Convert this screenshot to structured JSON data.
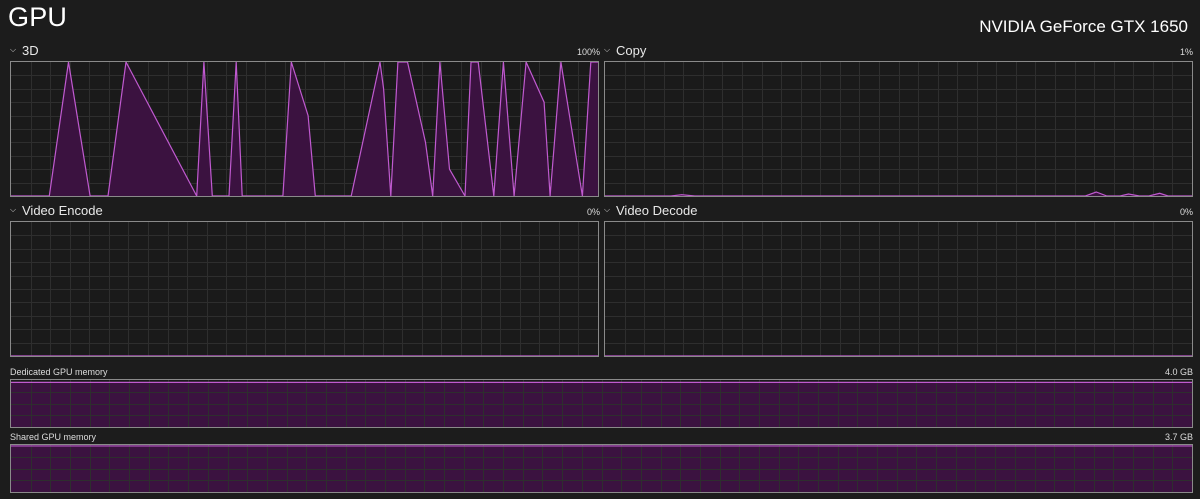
{
  "header": {
    "title": "GPU",
    "device_name": "NVIDIA GeForce GTX 1650"
  },
  "engines": [
    {
      "label": "3D",
      "value": "100%"
    },
    {
      "label": "Copy",
      "value": "1%"
    },
    {
      "label": "Video Encode",
      "value": "0%"
    },
    {
      "label": "Video Decode",
      "value": "0%"
    }
  ],
  "memory": {
    "dedicated": {
      "label": "Dedicated GPU memory",
      "value": "4.0 GB",
      "used_fraction": 0.95
    },
    "shared": {
      "label": "Shared GPU memory",
      "value": "3.7 GB",
      "used_fraction": 0.98
    }
  },
  "colors": {
    "line": "#c05ad0",
    "fill": "#3b1240",
    "grid": "#2e2e2e",
    "border": "#8a8a8a"
  },
  "icons": {
    "section_toggle": "chevron-down-icon"
  },
  "chart_data": [
    {
      "type": "area",
      "title": "3D",
      "ylim": [
        0,
        100
      ],
      "x": [
        0,
        3.2,
        4.8,
        6.6,
        8.1,
        9.6,
        15.5,
        16.1,
        16.8,
        18.2,
        18.8,
        19.3,
        22.7,
        23.4,
        24.8,
        25.4,
        28.4,
        30.8,
        31.1,
        31.7,
        32.3,
        33.1,
        34.6,
        35.2,
        35.8,
        36.6,
        37.9,
        38.4,
        39.0,
        40.3,
        41.1,
        42.0,
        43.0,
        44.5,
        45.0,
        45.9,
        47.7,
        48.4,
        49.0
      ],
      "values": [
        0,
        0,
        100,
        0,
        0,
        100,
        0,
        100,
        0,
        0,
        100,
        0,
        0,
        100,
        60,
        0,
        0,
        100,
        80,
        0,
        100,
        100,
        40,
        0,
        100,
        20,
        0,
        100,
        100,
        0,
        100,
        0,
        100,
        70,
        0,
        100,
        0,
        100,
        100
      ]
    },
    {
      "type": "area",
      "title": "Copy",
      "ylim": [
        0,
        100
      ],
      "x": [
        0,
        5.5,
        6.4,
        7.5,
        38.0,
        40.1,
        41.0,
        41.9,
        43.0,
        43.7,
        44.6,
        45.4,
        46.3,
        47.0,
        49.0
      ],
      "values": [
        0,
        0,
        1,
        0,
        0,
        0,
        3,
        0,
        0,
        1.5,
        0,
        0,
        2,
        0,
        0
      ]
    },
    {
      "type": "area",
      "title": "Video Encode",
      "ylim": [
        0,
        100
      ],
      "x": [
        0,
        49
      ],
      "values": [
        0,
        0
      ]
    },
    {
      "type": "area",
      "title": "Video Decode",
      "ylim": [
        0,
        100
      ],
      "x": [
        0,
        49
      ],
      "values": [
        0,
        0
      ]
    }
  ]
}
